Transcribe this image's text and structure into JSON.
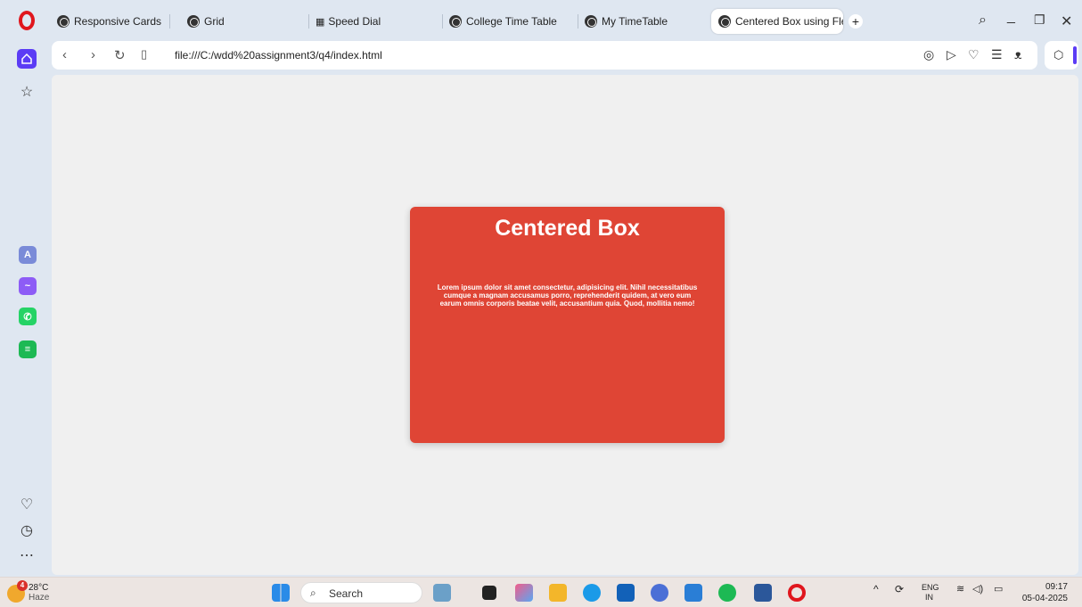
{
  "tabs": [
    {
      "label": "Responsive Cards",
      "icon": "globe-icon"
    },
    {
      "label": "Grid",
      "icon": "globe-icon"
    },
    {
      "label": "Speed Dial",
      "icon": "grid-icon"
    },
    {
      "label": "College Time Table",
      "icon": "globe-icon"
    },
    {
      "label": "My TimeTable",
      "icon": "globe-icon"
    },
    {
      "label": "Centered Box using Flexbo",
      "icon": "globe-icon",
      "active": true
    }
  ],
  "address": {
    "url": "file:///C:/wdd%20assignment3/q4/index.html"
  },
  "page": {
    "title": "Centered Box",
    "body": "Lorem ipsum dolor sit amet consectetur, adipisicing elit. Nihil necessitatibus cumque a magnam accusamus porro, reprehenderit quidem, at vero eum earum omnis corporis beatae velit, accusantium quia. Quod, mollitia nemo!",
    "card_color": "#df4535"
  },
  "taskbar": {
    "weather_temp": "28°C",
    "weather_desc": "Haze",
    "weather_badge": "4",
    "search_placeholder": "Search",
    "lang_top": "ENG",
    "lang_bottom": "IN",
    "time": "09:17",
    "date": "05-04-2025"
  },
  "colors": {
    "accent": "#5b3cf5",
    "opera_red": "#e0161d"
  }
}
